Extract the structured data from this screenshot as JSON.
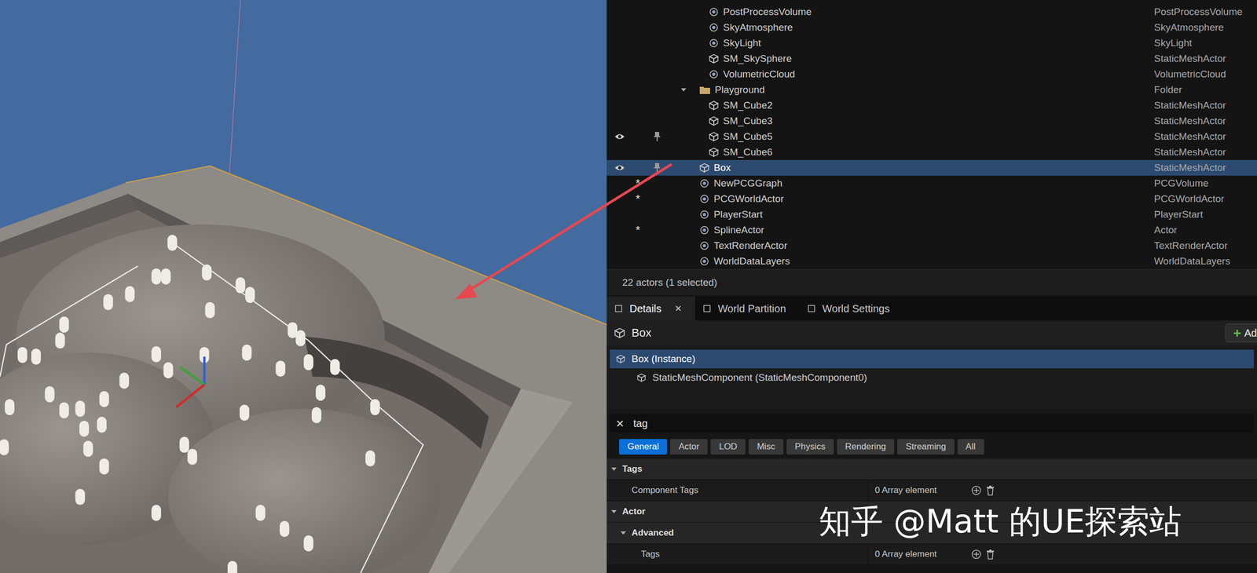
{
  "outliner": {
    "rows": [
      {
        "label": "PostProcessVolume",
        "type": "PostProcessVolume",
        "depth": 2,
        "kind": "actor",
        "expanded": false,
        "selected": false,
        "eye_shown": false,
        "pinned_shown": false,
        "badge": ""
      },
      {
        "label": "SkyAtmosphere",
        "type": "SkyAtmosphere",
        "depth": 2,
        "kind": "actor",
        "expanded": false,
        "selected": false,
        "eye_shown": false,
        "pinned_shown": false,
        "badge": ""
      },
      {
        "label": "SkyLight",
        "type": "SkyLight",
        "depth": 2,
        "kind": "actor",
        "expanded": false,
        "selected": false,
        "eye_shown": false,
        "pinned_shown": false,
        "badge": ""
      },
      {
        "label": "SM_SkySphere",
        "type": "StaticMeshActor",
        "depth": 2,
        "kind": "actor",
        "expanded": false,
        "selected": false,
        "eye_shown": false,
        "pinned_shown": false,
        "badge": ""
      },
      {
        "label": "VolumetricCloud",
        "type": "VolumetricCloud",
        "depth": 2,
        "kind": "actor",
        "expanded": false,
        "selected": false,
        "eye_shown": false,
        "pinned_shown": false,
        "badge": ""
      },
      {
        "label": "Playground",
        "type": "Folder",
        "depth": 1,
        "kind": "folder",
        "expanded": true,
        "selected": false,
        "eye_shown": false,
        "pinned_shown": false,
        "badge": ""
      },
      {
        "label": "SM_Cube2",
        "type": "StaticMeshActor",
        "depth": 2,
        "kind": "actor",
        "expanded": false,
        "selected": false,
        "eye_shown": false,
        "pinned_shown": false,
        "badge": ""
      },
      {
        "label": "SM_Cube3",
        "type": "StaticMeshActor",
        "depth": 2,
        "kind": "actor",
        "expanded": false,
        "selected": false,
        "eye_shown": false,
        "pinned_shown": false,
        "badge": ""
      },
      {
        "label": "SM_Cube5",
        "type": "StaticMeshActor",
        "depth": 2,
        "kind": "actor",
        "expanded": false,
        "selected": false,
        "eye_shown": true,
        "pinned_shown": true,
        "badge": ""
      },
      {
        "label": "SM_Cube6",
        "type": "StaticMeshActor",
        "depth": 2,
        "kind": "actor",
        "expanded": false,
        "selected": false,
        "eye_shown": false,
        "pinned_shown": false,
        "badge": ""
      },
      {
        "label": "Box",
        "type": "StaticMeshActor",
        "depth": 1,
        "kind": "actor",
        "expanded": false,
        "selected": true,
        "eye_shown": true,
        "pinned_shown": true,
        "badge": ""
      },
      {
        "label": "NewPCGGraph",
        "type": "PCGVolume",
        "depth": 1,
        "kind": "actor",
        "expanded": false,
        "selected": false,
        "eye_shown": false,
        "pinned_shown": false,
        "badge": "*"
      },
      {
        "label": "PCGWorldActor",
        "type": "PCGWorldActor",
        "depth": 1,
        "kind": "actor",
        "expanded": false,
        "selected": false,
        "eye_shown": false,
        "pinned_shown": false,
        "badge": "*"
      },
      {
        "label": "PlayerStart",
        "type": "PlayerStart",
        "depth": 1,
        "kind": "actor",
        "expanded": false,
        "selected": false,
        "eye_shown": false,
        "pinned_shown": false,
        "badge": ""
      },
      {
        "label": "SplineActor",
        "type": "Actor",
        "depth": 1,
        "kind": "actor",
        "expanded": false,
        "selected": false,
        "eye_shown": false,
        "pinned_shown": false,
        "badge": "*"
      },
      {
        "label": "TextRenderActor",
        "type": "TextRenderActor",
        "depth": 1,
        "kind": "actor",
        "expanded": false,
        "selected": false,
        "eye_shown": false,
        "pinned_shown": false,
        "badge": ""
      },
      {
        "label": "WorldDataLayers",
        "type": "WorldDataLayers",
        "depth": 1,
        "kind": "actor",
        "expanded": false,
        "selected": false,
        "eye_shown": false,
        "pinned_shown": false,
        "badge": ""
      }
    ],
    "status": "22 actors (1 selected)"
  },
  "tabs": [
    {
      "label": "Details",
      "selected": true,
      "close": "×"
    },
    {
      "label": "World Partition",
      "selected": false,
      "close": ""
    },
    {
      "label": "World Settings",
      "selected": false,
      "close": ""
    }
  ],
  "details": {
    "title": "Box",
    "add_button": {
      "icon": "+",
      "label": "Ad"
    },
    "components": [
      {
        "label": "Box (Instance)",
        "selected": true,
        "depth": 0
      },
      {
        "label": "StaticMeshComponent (StaticMeshComponent0)",
        "selected": false,
        "depth": 1
      }
    ],
    "search": {
      "clear": "×",
      "value": "tag"
    },
    "filters": [
      {
        "label": "General",
        "selected": true
      },
      {
        "label": "Actor",
        "selected": false
      },
      {
        "label": "LOD",
        "selected": false
      },
      {
        "label": "Misc",
        "selected": false
      },
      {
        "label": "Physics",
        "selected": false
      },
      {
        "label": "Rendering",
        "selected": false
      },
      {
        "label": "Streaming",
        "selected": false
      },
      {
        "label": "All",
        "selected": false
      }
    ],
    "properties": [
      {
        "kind": "category",
        "label": "Tags",
        "depth": 0,
        "expanded": true,
        "value": ""
      },
      {
        "kind": "property",
        "label": "Component Tags",
        "depth": 1,
        "expanded": false,
        "value": "0 Array element"
      },
      {
        "kind": "category",
        "label": "Actor",
        "depth": 0,
        "expanded": true,
        "value": ""
      },
      {
        "kind": "category",
        "label": "Advanced",
        "depth": 1,
        "expanded": true,
        "value": ""
      },
      {
        "kind": "property",
        "label": "Tags",
        "depth": 2,
        "expanded": false,
        "value": "0 Array element"
      }
    ]
  },
  "watermark": "知乎 @Matt 的UE探索站"
}
